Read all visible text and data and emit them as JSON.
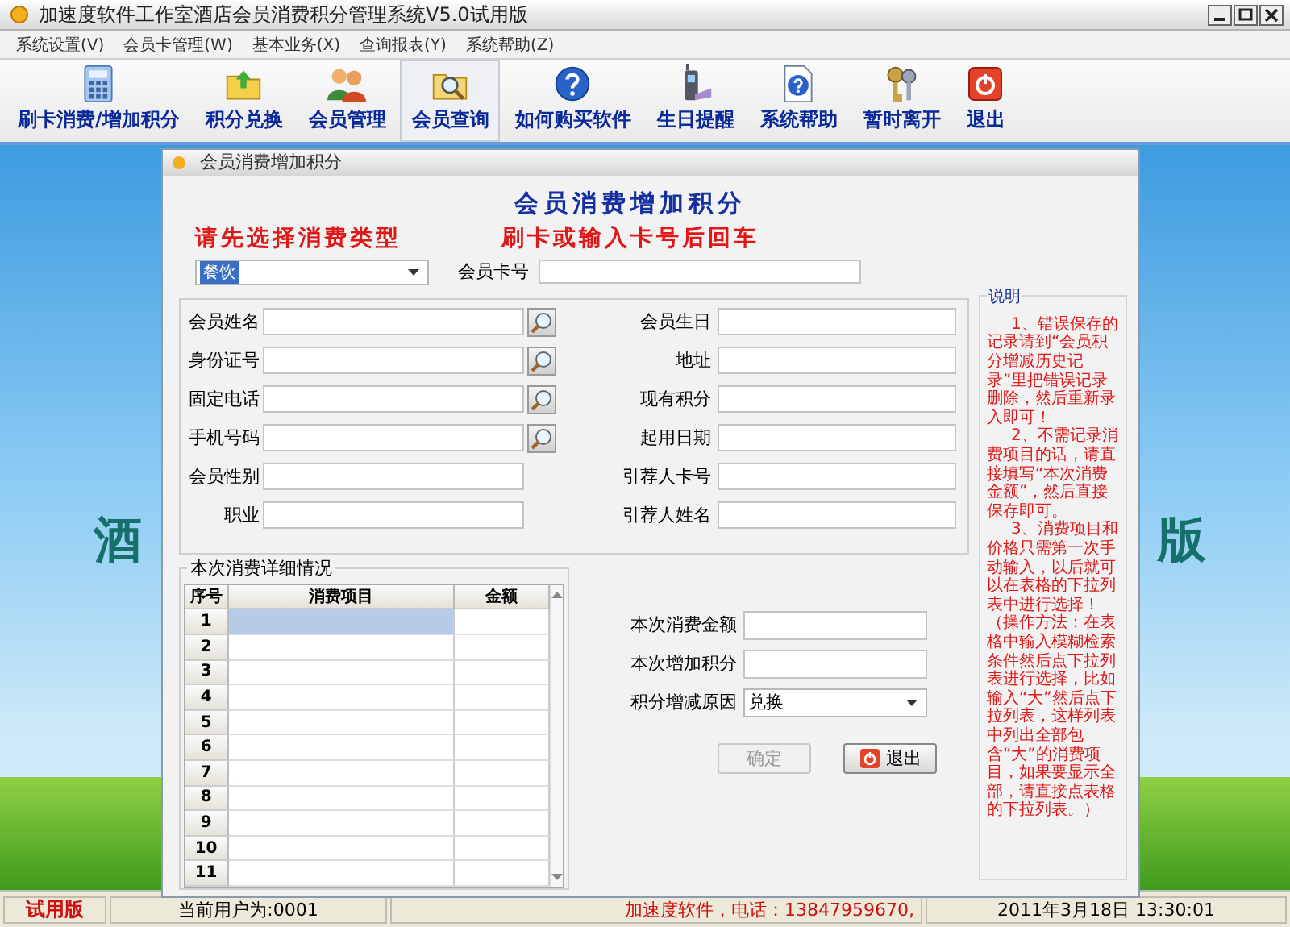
{
  "window": {
    "title": "加速度软件工作室酒店会员消费积分管理系统V5.0试用版"
  },
  "menu": [
    "系统设置(V)",
    "会员卡管理(W)",
    "基本业务(X)",
    "查询报表(Y)",
    "系统帮助(Z)"
  ],
  "toolbar": [
    {
      "label": "刷卡消费/增加积分",
      "selected": false
    },
    {
      "label": "积分兑换",
      "selected": false
    },
    {
      "label": "会员管理",
      "selected": false
    },
    {
      "label": "会员查询",
      "selected": true
    },
    {
      "label": "如何购买软件",
      "selected": false
    },
    {
      "label": "生日提醒",
      "selected": false
    },
    {
      "label": "系统帮助",
      "selected": false
    },
    {
      "label": "暂时离开",
      "selected": false
    },
    {
      "label": "退出",
      "selected": false
    }
  ],
  "background_texts": [
    "酒",
    "版"
  ],
  "dialog": {
    "title": "会员消费增加积分",
    "heading": "会员消费增加积分",
    "hint_left": "请先选择消费类型",
    "hint_right": "刷卡或输入卡号后回车",
    "consumption_type": {
      "value": "餐饮"
    },
    "card_number": {
      "label": "会员卡号"
    },
    "left_fields": [
      {
        "label": "会员姓名",
        "search_button": true
      },
      {
        "label": "身份证号",
        "search_button": true
      },
      {
        "label": "固定电话",
        "search_button": true
      },
      {
        "label": "手机号码",
        "search_button": true
      },
      {
        "label": "会员性别",
        "search_button": false
      },
      {
        "label": "职业",
        "search_button": false
      }
    ],
    "right_fields": [
      {
        "label": "会员生日"
      },
      {
        "label": "地址"
      },
      {
        "label": "现有积分"
      },
      {
        "label": "起用日期"
      },
      {
        "label": "引荐人卡号"
      },
      {
        "label": "引荐人姓名"
      }
    ],
    "table": {
      "title": "本次消费详细情况",
      "columns": [
        "序号",
        "消费项目",
        "金额"
      ],
      "rows": [
        {
          "number": "1",
          "selected": true
        },
        {
          "number": "2",
          "selected": false
        },
        {
          "number": "3",
          "selected": false
        },
        {
          "number": "4",
          "selected": false
        },
        {
          "number": "5",
          "selected": false
        },
        {
          "number": "6",
          "selected": false
        },
        {
          "number": "7",
          "selected": false
        },
        {
          "number": "8",
          "selected": false
        },
        {
          "number": "9",
          "selected": false
        },
        {
          "number": "10",
          "selected": false
        },
        {
          "number": "11",
          "selected": false
        }
      ]
    },
    "summary_fields": [
      {
        "label": "本次消费金额",
        "kind": "text"
      },
      {
        "label": "本次增加积分",
        "kind": "text"
      },
      {
        "label": "积分增减原因",
        "kind": "select",
        "value": "兑换"
      }
    ],
    "buttons": [
      {
        "label": "确定",
        "disabled": true,
        "kind": "plain"
      },
      {
        "label": "退出",
        "disabled": false,
        "kind": "exit"
      }
    ],
    "notes": {
      "title": "说明",
      "paragraphs": [
        "1、错误保存的记录请到“会员积分增减历史记录”里把错误记录删除，然后重新录入即可！",
        "2、不需记录消费项目的话，请直接填写“本次消费金额”，然后直接保存即可。",
        "3、消费项目和价格只需第一次手动输入，以后就可以在表格的下拉列表中进行选择！（操作方法：在表格中输入模糊检索条件然后点下拉列表进行选择，比如输入“大”然后点下拉列表，这样列表中列出全部包含“大”的消费项目，如果要显示全部，请直接点表格的下拉列表。）"
      ]
    }
  },
  "status_bar": {
    "edition": "试用版",
    "user": "当前用户为:0001",
    "contact": "加速度软件，电话：13847959670,",
    "datetime": "2011年3月18日  13:30:01"
  }
}
